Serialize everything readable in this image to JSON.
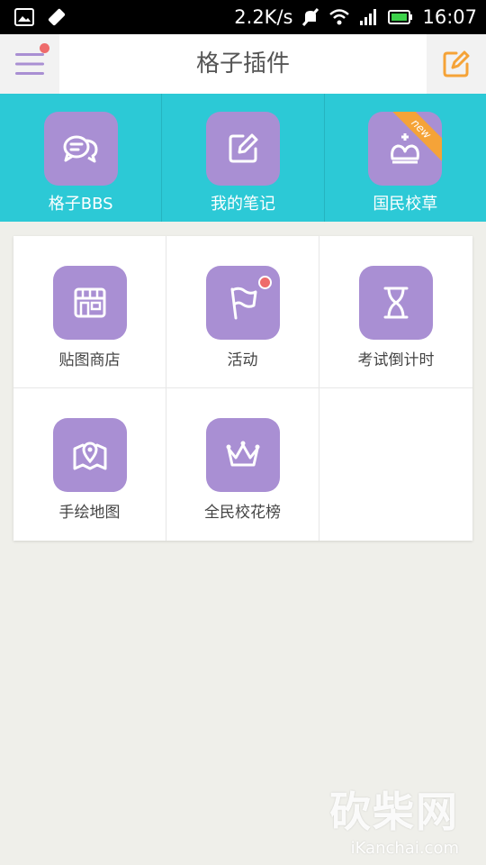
{
  "status_bar": {
    "net_speed": "2.2K/s",
    "time": "16:07"
  },
  "app_bar": {
    "title": "格子插件"
  },
  "top_items": [
    {
      "label": "格子BBS",
      "icon": "chat-icon"
    },
    {
      "label": "我的笔记",
      "icon": "edit-note-icon"
    },
    {
      "label": "国民校草",
      "icon": "crown-icon",
      "ribbon": "new"
    }
  ],
  "grid_items": [
    {
      "label": "贴图商店",
      "icon": "store-icon"
    },
    {
      "label": "活动",
      "icon": "flag-icon"
    },
    {
      "label": "考试倒计时",
      "icon": "hourglass-icon"
    },
    {
      "label": "手绘地图",
      "icon": "map-icon"
    },
    {
      "label": "全民校花榜",
      "icon": "tiara-icon"
    }
  ],
  "watermark": {
    "main": "砍柴网",
    "sub": "iKanchai.com"
  },
  "colors": {
    "accent_teal": "#2cc9d6",
    "tile_purple": "#a98fd3",
    "edit_orange": "#f5a338",
    "badge_red": "#ee6b6b"
  }
}
